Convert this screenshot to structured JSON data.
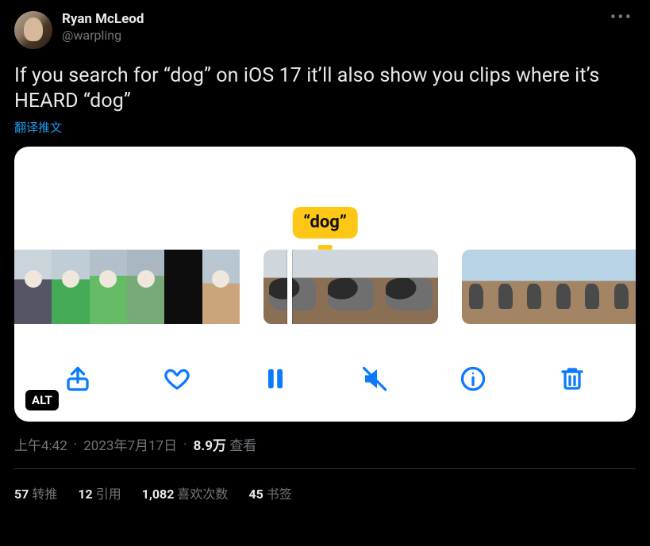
{
  "author": {
    "display_name": "Ryan McLeod",
    "handle": "@warpling"
  },
  "tweet_text": "If you search for “dog” on iOS 17 it’ll also show you clips where it’s HEARD “dog”",
  "translate_label": "翻译推文",
  "media": {
    "tooltip": "“dog”",
    "alt_badge": "ALT"
  },
  "meta": {
    "time": "上午4:42",
    "date": "2023年7月17日",
    "views_count": "8.9万",
    "views_label": "查看"
  },
  "stats": {
    "retweets_count": "57",
    "retweets_label": "转推",
    "quotes_count": "12",
    "quotes_label": "引用",
    "likes_count": "1,082",
    "likes_label": "喜欢次数",
    "bookmarks_count": "45",
    "bookmarks_label": "书签"
  }
}
